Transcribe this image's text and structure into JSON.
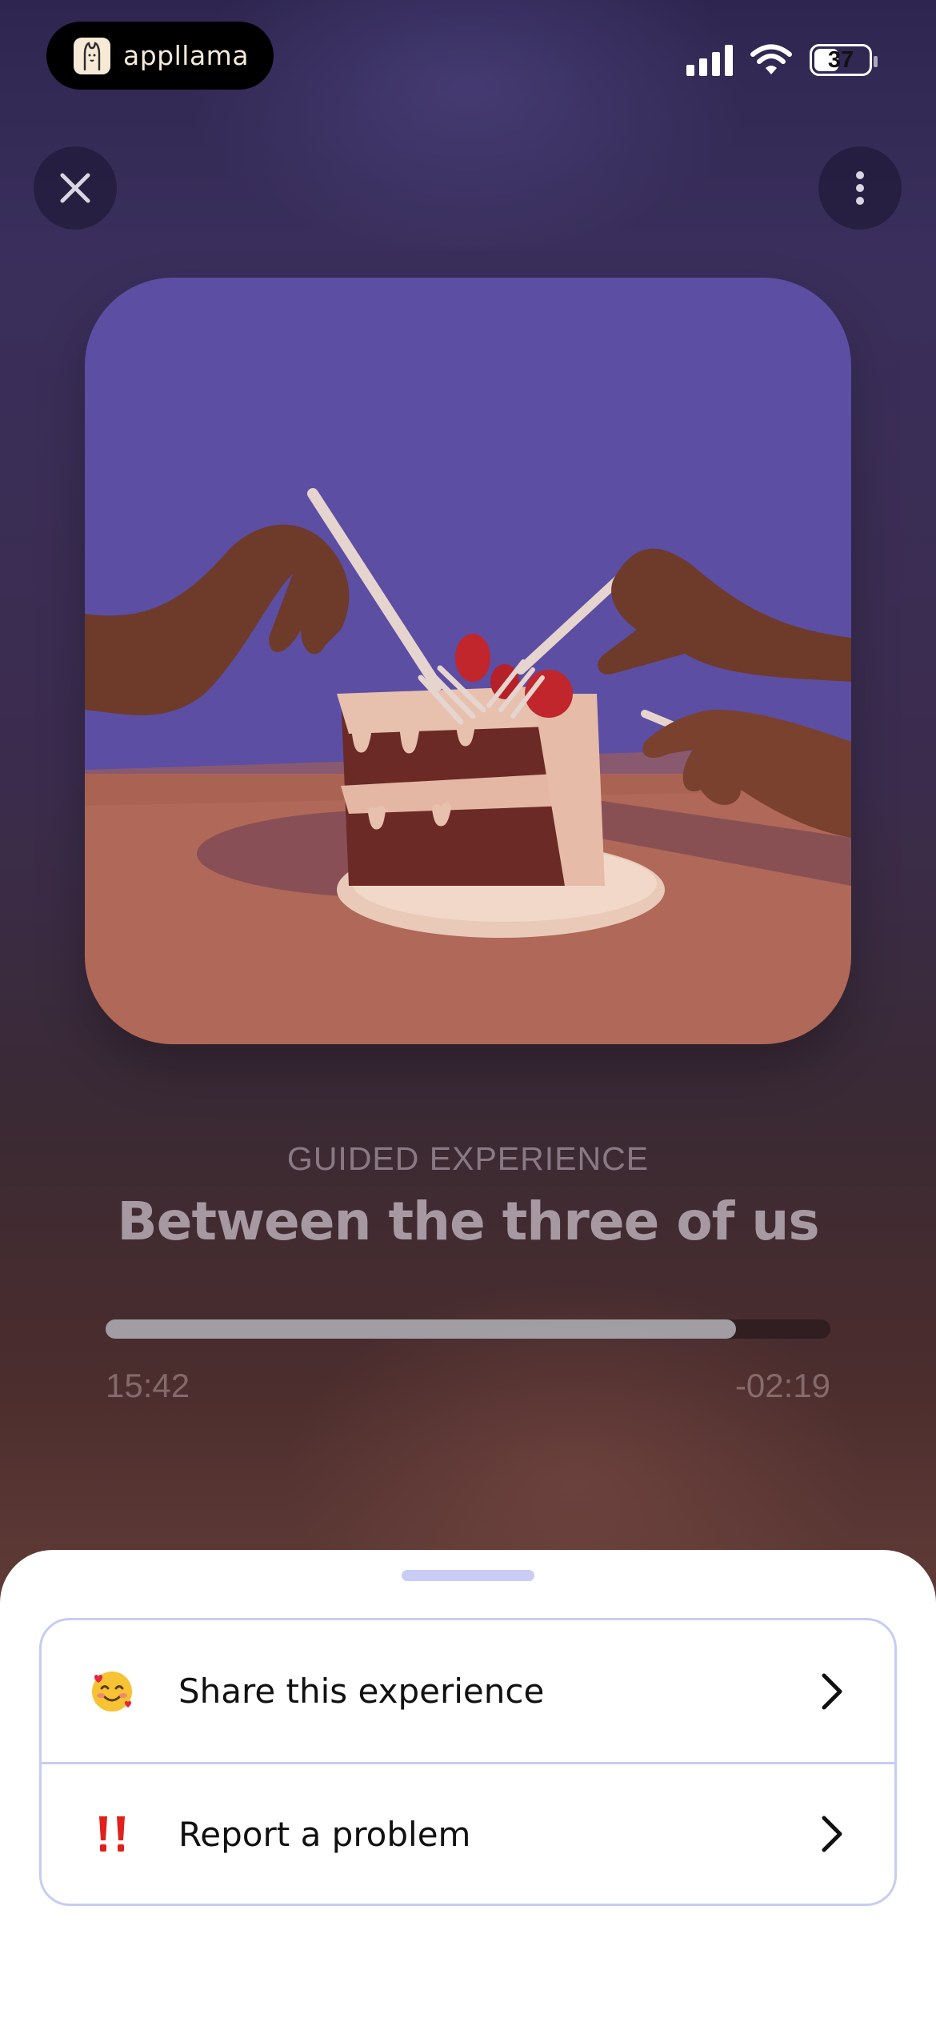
{
  "status_bar": {
    "app_name": "appllama",
    "battery_level": "37"
  },
  "player": {
    "eyebrow": "GUIDED EXPERIENCE",
    "title": "Between the three of us",
    "progress": 0.87,
    "elapsed": "15:42",
    "remaining": "-02:19"
  },
  "sheet": {
    "items": [
      {
        "icon": "smiling-face-with-hearts-icon",
        "label": "Share this experience"
      },
      {
        "icon": "double-exclamation-icon",
        "label": "Report a problem"
      }
    ]
  },
  "colors": {
    "sheet_border": "#c6cdf3",
    "handle": "#c9cdf5",
    "art_background": "#5c4ea3",
    "art_table": "#b06858"
  }
}
